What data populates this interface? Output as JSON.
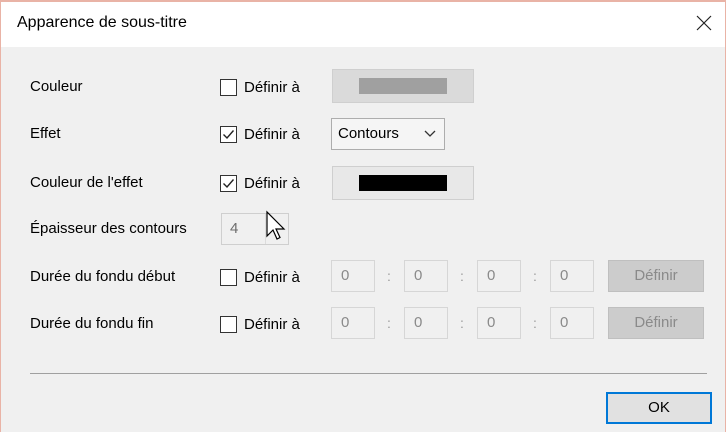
{
  "dialog": {
    "title": "Apparence de sous-titre",
    "close_icon": "close-icon"
  },
  "rows": {
    "couleur": {
      "label": "Couleur",
      "checkbox_label": "Définir à",
      "checked": false,
      "swatch_color": "#a0a0a0"
    },
    "effet": {
      "label": "Effet",
      "checkbox_label": "Définir à",
      "checked": true,
      "selected": "Contours"
    },
    "couleur_effet": {
      "label": "Couleur de l'effet",
      "checkbox_label": "Définir à",
      "checked": true,
      "swatch_color": "#000000"
    },
    "epaisseur": {
      "label": "Épaisseur des contours",
      "value": "4"
    },
    "fondu_debut": {
      "label": "Durée du fondu début",
      "checkbox_label": "Définir à",
      "checked": false,
      "fields": [
        "0",
        "0",
        "0",
        "0"
      ],
      "separator": ":",
      "button": "Définir"
    },
    "fondu_fin": {
      "label": "Durée du fondu fin",
      "checkbox_label": "Définir à",
      "checked": false,
      "fields": [
        "0",
        "0",
        "0",
        "0"
      ],
      "separator": ":",
      "button": "Définir"
    }
  },
  "footer": {
    "ok_label": "OK"
  },
  "colors": {
    "accent": "#0078d7",
    "dialog_bg": "#f0f0f0",
    "disabled_text": "#8a8a8a"
  }
}
